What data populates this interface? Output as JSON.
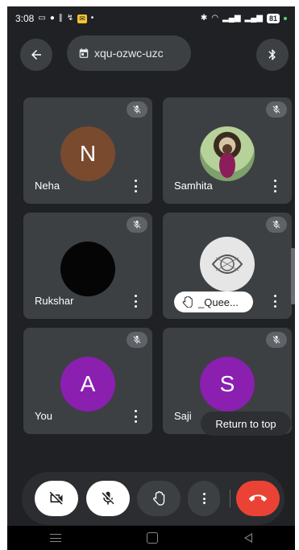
{
  "status_bar": {
    "time": "3:08",
    "battery": "81",
    "left_icons": [
      "cast-icon",
      "chat-icon",
      "wifi-calling-icon",
      "vibrate-icon"
    ],
    "right_icons": [
      "bluetooth-icon",
      "wifi-icon",
      "signal-icon"
    ]
  },
  "header": {
    "meeting_code": "xqu-ozwc-uzc"
  },
  "tiles": [
    {
      "name": "Neha",
      "initial": "N",
      "avatar_color": "#7a4a2e",
      "muted": true
    },
    {
      "name": "Samhita",
      "initial": "",
      "avatar_color": "#a9c7a0",
      "muted": true
    },
    {
      "name": "Rukshar",
      "initial": "",
      "avatar_color": "#050505",
      "muted": true
    },
    {
      "name": "_Quee...",
      "initial": "",
      "avatar_color": "#d9d9d9",
      "muted": true,
      "hand_raised": true
    },
    {
      "name": "You",
      "initial": "A",
      "avatar_color": "#8a1fb0",
      "muted": true
    },
    {
      "name": "Saji",
      "initial": "S",
      "avatar_color": "#8a1fb0",
      "muted": true
    }
  ],
  "return_to_top": "Return to top",
  "colors": {
    "background": "#1f2125",
    "tile": "#3c4043",
    "end_call": "#ea4335"
  }
}
